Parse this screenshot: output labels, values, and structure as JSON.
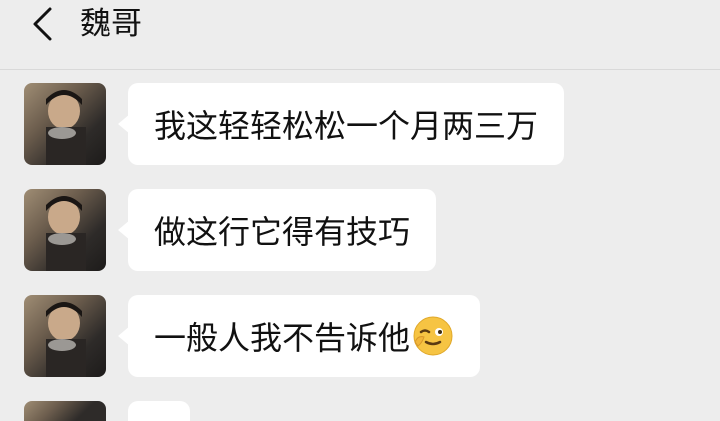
{
  "header": {
    "back_icon": "chevron-left-icon",
    "title": "魏哥"
  },
  "messages": [
    {
      "text": "我这轻轻松松一个月两三万"
    },
    {
      "text": "做这行它得有技巧"
    },
    {
      "text": "一般人我不告诉他",
      "emoji": "wink-face-emoji"
    }
  ],
  "colors": {
    "background": "#ededed",
    "bubble": "#ffffff",
    "text": "#111111"
  }
}
